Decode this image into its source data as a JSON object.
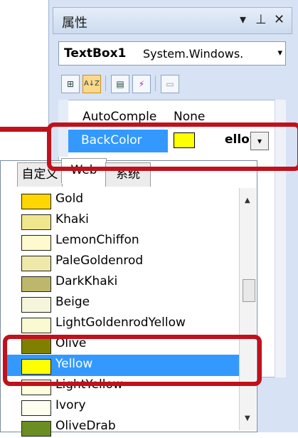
{
  "window": {
    "title": "属性",
    "ctrl_dropdown": "▾",
    "ctrl_pin": "⊥",
    "ctrl_close": "✕"
  },
  "object_selector": {
    "name": "TextBox1",
    "type": "System.Windows.",
    "arrow": "▾"
  },
  "toolbar": {
    "categorized": "⊞",
    "alphabetical": "A↓Z",
    "properties": "▤",
    "events": "⚡",
    "property_pages": "▭"
  },
  "properties": [
    {
      "name": "AutoComple",
      "value": "None"
    },
    {
      "name": "BackColor",
      "value": "ellow"
    }
  ],
  "backcolor_dropdown_arrow": "▾",
  "palette": {
    "tabs": [
      "自定义",
      "Web",
      "系统"
    ],
    "selected_tab": "Web",
    "items": [
      {
        "label": "Gold",
        "color": "#ffd700"
      },
      {
        "label": "Khaki",
        "color": "#f0e68c"
      },
      {
        "label": "LemonChiffon",
        "color": "#fffacd"
      },
      {
        "label": "PaleGoldenrod",
        "color": "#eee8aa"
      },
      {
        "label": "DarkKhaki",
        "color": "#bdb76b"
      },
      {
        "label": "Beige",
        "color": "#f5f5dc"
      },
      {
        "label": "LightGoldenrodYellow",
        "color": "#fafad2"
      },
      {
        "label": "Olive",
        "color": "#808000"
      },
      {
        "label": "Yellow",
        "color": "#ffff00"
      },
      {
        "label": "LightYellow",
        "color": "#ffffe0"
      },
      {
        "label": "Ivory",
        "color": "#fffff0"
      },
      {
        "label": "OliveDrab",
        "color": "#6b8e23"
      }
    ],
    "selected_item": "Yellow",
    "scroll_up": "▲",
    "scroll_down": "▼"
  },
  "colors": {
    "highlight": "#c0111c",
    "selection": "#3399ff",
    "backcolor_swatch": "#ffff00"
  }
}
